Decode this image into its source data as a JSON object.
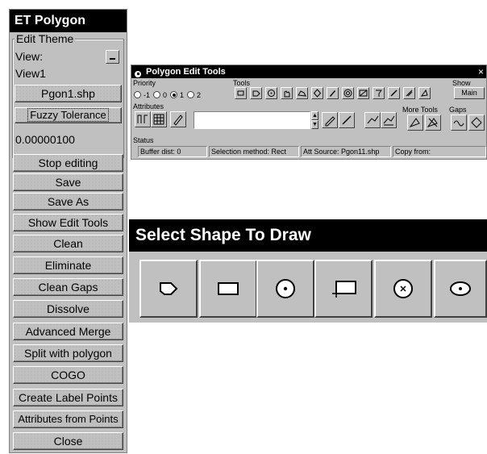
{
  "et_polygon": {
    "title": "ET Polygon",
    "group_label": "Edit Theme",
    "view_label": "View:",
    "view_value": "View1",
    "theme_button": "Pgon1.shp",
    "fuzzy_button": "Fuzzy Tolerance",
    "tolerance_value": "0.00000100",
    "buttons": [
      "Stop editing",
      "Save",
      "Save As",
      "Show Edit Tools",
      "Clean",
      "Eliminate",
      "Clean Gaps",
      "Dissolve",
      "Advanced Merge",
      "Split with polygon",
      "COGO",
      "Create Label Points",
      "Attributes from Points",
      "Close"
    ]
  },
  "edit_tools": {
    "title": "Polygon Edit Tools",
    "close_glyph": "×",
    "priority_label": "Priority",
    "priority_options": [
      "-1",
      "0",
      "1",
      "2"
    ],
    "priority_selected": "1",
    "tools_label": "Tools",
    "show_label": "Show",
    "show_button": "Main",
    "attributes_label": "Attributes",
    "more_tools_label": "More Tools",
    "gaps_label": "Gaps",
    "status_label": "Status",
    "status": {
      "buffer": "Buffer dist: 0",
      "selection": "Selection method: Rect",
      "att_source": "Att Source: Pgon11.shp",
      "copy_from": "Copy from:"
    }
  },
  "shape_picker": {
    "title": "Select Shape To Draw",
    "shapes": [
      "polygon-icon",
      "rectangle-icon",
      "circle-center-icon",
      "rectangle-corner-icon",
      "circle-x-icon",
      "ellipse-icon"
    ]
  }
}
